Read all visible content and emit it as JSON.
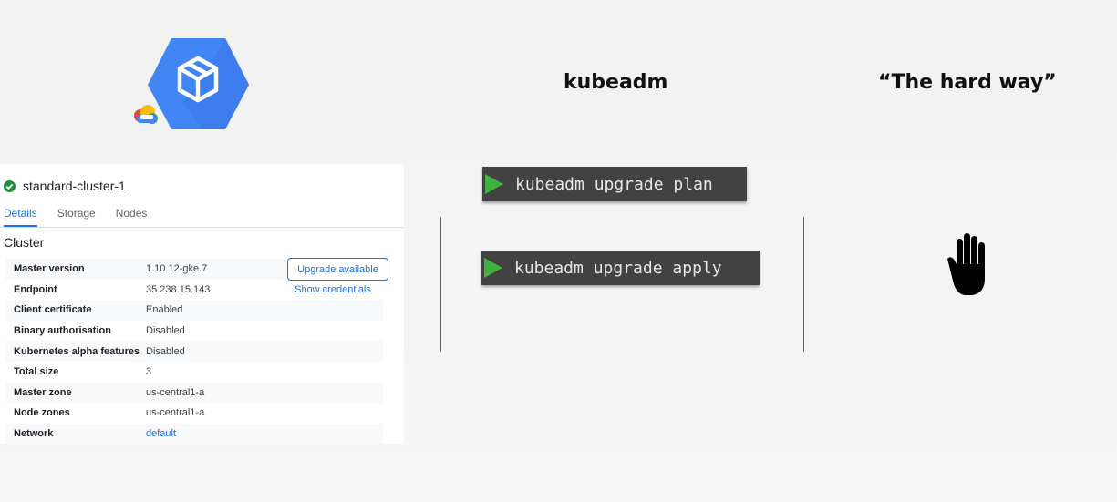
{
  "headings": {
    "kubeadm": "kubeadm",
    "hard_way": "“The hard way”"
  },
  "gke": {
    "cluster_name": "standard-cluster-1",
    "tabs": [
      "Details",
      "Storage",
      "Nodes"
    ],
    "active_tab": "Details",
    "section_title": "Cluster",
    "rows": [
      {
        "key": "Master version",
        "value": "1.10.12-gke.7"
      },
      {
        "key": "Endpoint",
        "value": "35.238.15.143",
        "action": "Show credentials"
      },
      {
        "key": "Client certificate",
        "value": "Enabled"
      },
      {
        "key": "Binary authorisation",
        "value": "Disabled"
      },
      {
        "key": "Kubernetes alpha features",
        "value": "Disabled"
      },
      {
        "key": "Total size",
        "value": "3"
      },
      {
        "key": "Master zone",
        "value": "us-central1-a"
      },
      {
        "key": "Node zones",
        "value": "us-central1-a"
      },
      {
        "key": "Network",
        "value": "default"
      }
    ],
    "upgrade_button": "Upgrade available",
    "status_color": "#1e8e3e",
    "accent_color": "#1a73e8"
  },
  "commands": {
    "plan": "kubeadm upgrade plan",
    "apply": "kubeadm upgrade apply"
  },
  "icons": {
    "gke_logo": "google-kubernetes-engine-logo",
    "cloud": "google-cloud-icon",
    "check": "check-circle-icon",
    "play": "play-triangle-icon",
    "hand": "stop-hand-icon"
  }
}
